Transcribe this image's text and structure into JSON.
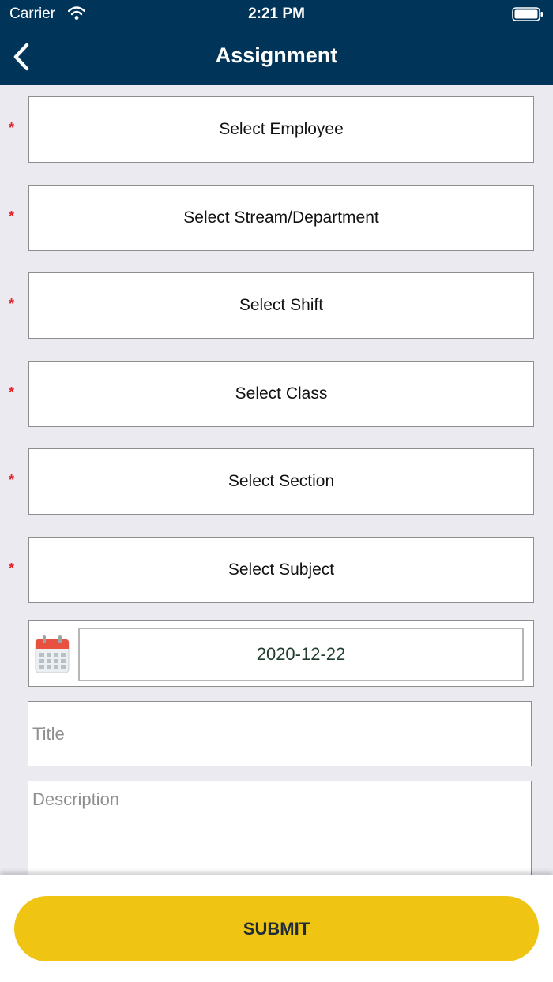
{
  "status_bar": {
    "carrier": "Carrier",
    "time": "2:21 PM"
  },
  "nav": {
    "title": "Assignment",
    "back_icon": "chevron-left-icon"
  },
  "form": {
    "required_marker": "*",
    "selectors": [
      {
        "label": "Select Employee",
        "required": true
      },
      {
        "label": "Select Stream/Department",
        "required": true
      },
      {
        "label": "Select Shift",
        "required": true
      },
      {
        "label": "Select Class",
        "required": true
      },
      {
        "label": "Select Section",
        "required": true
      },
      {
        "label": "Select Subject",
        "required": true
      }
    ],
    "date": {
      "icon": "calendar-icon",
      "value": "2020-12-22"
    },
    "title_field": {
      "placeholder": "Title",
      "value": ""
    },
    "description_field": {
      "placeholder": "Description",
      "value": ""
    }
  },
  "submit": {
    "label": "SUBMIT"
  },
  "colors": {
    "header_bg": "#003459",
    "page_bg": "#ebeaf0",
    "required": "#e8232c",
    "submit_bg": "#f0c413",
    "date_text": "#1f3d2c"
  }
}
